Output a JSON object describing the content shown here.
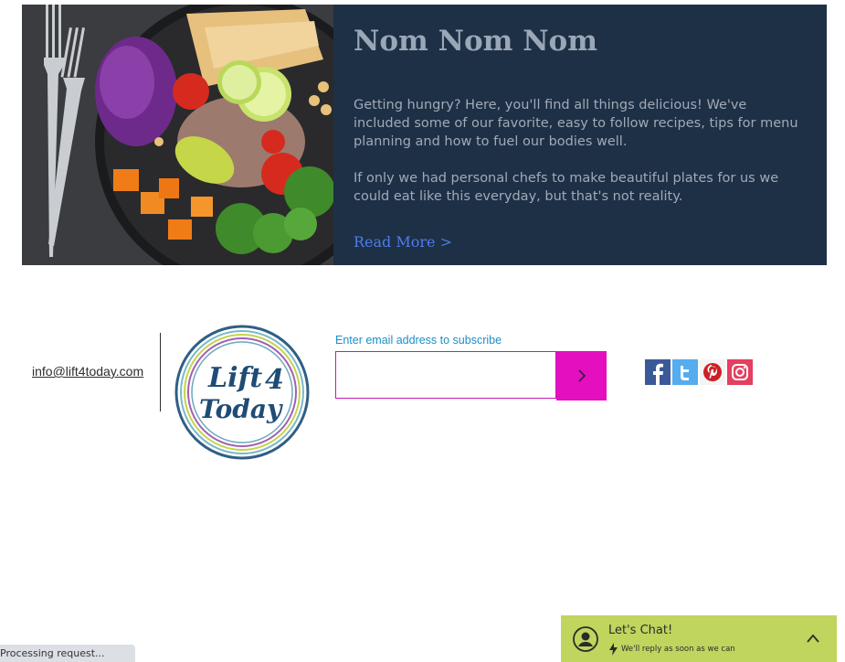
{
  "hero": {
    "title": "Nom Nom Nom",
    "paragraph1": "Getting hungry? Here, you'll find all things delicious! We've included some of our favorite, easy to follow recipes, tips for menu planning and how to fuel our bodies well.",
    "paragraph2": "If only we had personal chefs to make beautiful plates for us we could eat like this everyday, but that's not reality.",
    "read_more": "Read More >"
  },
  "footer": {
    "email": "info@lift4today.com",
    "logo_text": "Lift 4 Today",
    "subscribe_label": "Enter email address to subscribe",
    "subscribe_placeholder": "",
    "social": [
      {
        "name": "facebook-icon",
        "color": "#3b5998"
      },
      {
        "name": "twitter-icon",
        "color": "#55acee"
      },
      {
        "name": "pinterest-icon",
        "color": "#cb2027"
      },
      {
        "name": "instagram-icon",
        "color": "#e4405f"
      }
    ]
  },
  "status": {
    "text": "Processing request..."
  },
  "chat": {
    "title": "Let's Chat!",
    "subtitle": "We'll reply as soon as we can"
  },
  "colors": {
    "panel": "#1e3046",
    "accent_magenta": "#e40fbf",
    "link_blue": "#4e7de8",
    "chat_green": "#bfd55d"
  }
}
